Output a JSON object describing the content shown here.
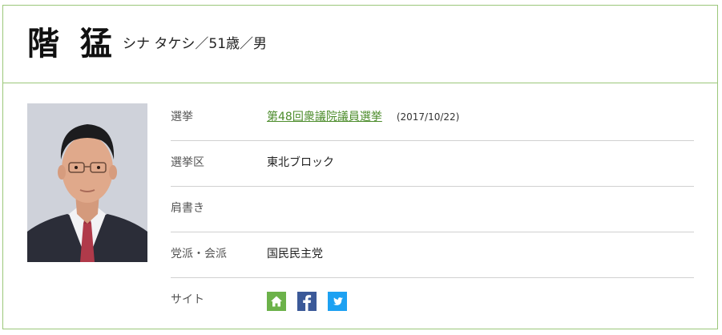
{
  "profile": {
    "name": "階 猛",
    "reading": "シナ タケシ／51歳／男"
  },
  "rows": [
    {
      "label": "選挙",
      "value": "第48回衆議院議員選挙",
      "date": "(2017/10/22)"
    },
    {
      "label": "選挙区",
      "value": "東北ブロック"
    },
    {
      "label": "肩書き",
      "value": ""
    },
    {
      "label": "党派・会派",
      "value": "国民民主党"
    },
    {
      "label": "サイト"
    }
  ],
  "site_icons": [
    {
      "icon": "home-icon",
      "color": "#6cb24a"
    },
    {
      "icon": "facebook-icon",
      "color": "#3b5998"
    },
    {
      "icon": "twitter-icon",
      "color": "#1da1f2"
    }
  ],
  "colors": {
    "border": "#9bc77a",
    "link": "#4c8c2b",
    "divider": "#d0d0d0"
  }
}
